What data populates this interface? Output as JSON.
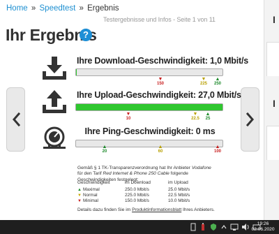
{
  "breadcrumb": {
    "home": "Home",
    "speedtest": "Speedtest",
    "current": "Ergebnis",
    "separator": "»"
  },
  "subtitle": "Testergebnisse und Infos - Seite 1 von 11",
  "title": "Ihr Ergebnis",
  "help_icon": "?",
  "rows": [
    {
      "label": "Ihre Download-Geschwindigkeit: 1,0 Mbit/s",
      "progress_percent": 0.5,
      "markers": [
        {
          "value": "150",
          "color": "red"
        },
        {
          "value": "225",
          "color": "yellow"
        },
        {
          "value": "250",
          "color": "green"
        }
      ]
    },
    {
      "label": "Ihre Upload-Geschwindigkeit: 27,0 Mbit/s",
      "progress_percent": 100,
      "markers": [
        {
          "value": "10",
          "color": "red"
        },
        {
          "value": "22.5",
          "color": "yellow"
        },
        {
          "value": "25",
          "color": "green"
        }
      ]
    },
    {
      "label": "Ihre Ping-Geschwindigkeit: 0 ms",
      "progress_percent": 0,
      "markers": [
        {
          "value": "20",
          "color": "green"
        },
        {
          "value": "60",
          "color": "yellow"
        },
        {
          "value": "100",
          "color": "red"
        }
      ]
    }
  ],
  "info": {
    "line1_a": "Gemäß § 1 TK-Transparenzverordnung hat Ihr Anbieter ",
    "provider": "Vodafone",
    "line1_b": " für den Tarif ",
    "tariff": "Red Internet & Phone 250 Cable",
    "line1_c": " folgende Geschwindigkeiten festgelegt:"
  },
  "table": {
    "headers": [
      "Geschwindigkeit",
      "im Download",
      "im Upload"
    ],
    "rows": [
      {
        "name": "Maximal",
        "download": "250.0 Mbit/s",
        "upload": "25.0 Mbit/s"
      },
      {
        "name": "Normal",
        "download": "225.0 Mbit/s",
        "upload": "22.5 Mbit/s"
      },
      {
        "name": "Minimal",
        "download": "150.0 Mbit/s",
        "upload": "10.0 Mbit/s"
      }
    ]
  },
  "footer": {
    "text_a": "Details dazu finden Sie im ",
    "link": "Produktinformationsblatt",
    "text_b": " Ihres Anbieters."
  },
  "right_col": {
    "h1": "I",
    "h2": "I"
  },
  "taskbar": {
    "time": "19:26",
    "date": "02.06.2020"
  },
  "colors": {
    "accent": "#1d8fd1",
    "progress": "#2fc72f",
    "red": "#c81e1e",
    "yellow": "#b8a000",
    "green": "#1d8a2b"
  },
  "icons": [
    "download-icon",
    "upload-icon",
    "ping-gauge-icon",
    "chevron-left-icon",
    "chevron-right-icon",
    "help-icon"
  ]
}
